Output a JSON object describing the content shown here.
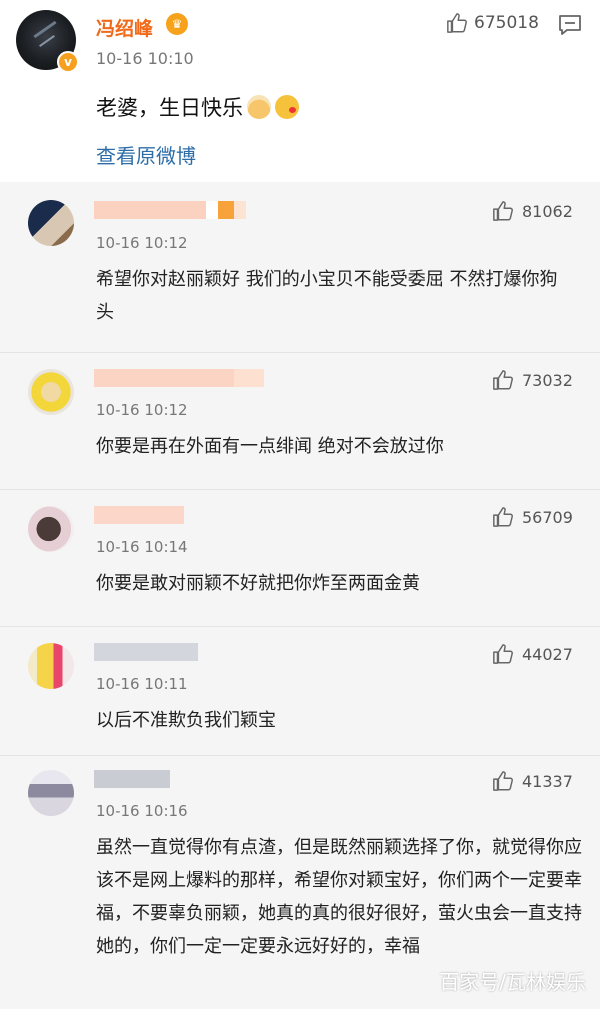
{
  "post": {
    "author": "冯绍峰",
    "time": "10-16 10:10",
    "likes": "675018",
    "text": "老婆，生日快乐",
    "link": "查看原微博"
  },
  "comments": [
    {
      "time": "10-16 10:12",
      "likes": "81062",
      "text": "希望你对赵丽颖好 我们的小宝贝不能受委屈 不然打爆你狗头"
    },
    {
      "time": "10-16 10:12",
      "likes": "73032",
      "text": "你要是再在外面有一点绯闻  绝对不会放过你"
    },
    {
      "time": "10-16 10:14",
      "likes": "56709",
      "text": "你要是敢对丽颖不好就把你炸至两面金黄"
    },
    {
      "time": "10-16 10:11",
      "likes": "44027",
      "text": "以后不准欺负我们颖宝"
    },
    {
      "time": "10-16 10:16",
      "likes": "41337",
      "text": "虽然一直觉得你有点渣，但是既然丽颖选择了你，就觉得你应该不是网上爆料的那样，希望你对颖宝好，你们两个一定要幸福，不要辜负丽颖，她真的真的很好很好，萤火虫会一直支持她的，你们一定一定要永远好好的，幸福"
    }
  ],
  "watermark": "百家号/瓦林娱乐",
  "icons": {
    "like": "thumbs-up-icon",
    "comment": "comment-icon",
    "verified": "verified-badge-icon",
    "vip": "vip-crown-icon"
  },
  "colors": {
    "author_name": "#f06a1a",
    "link": "#2d6ea8",
    "comment_bg": "#f5f5f5"
  }
}
